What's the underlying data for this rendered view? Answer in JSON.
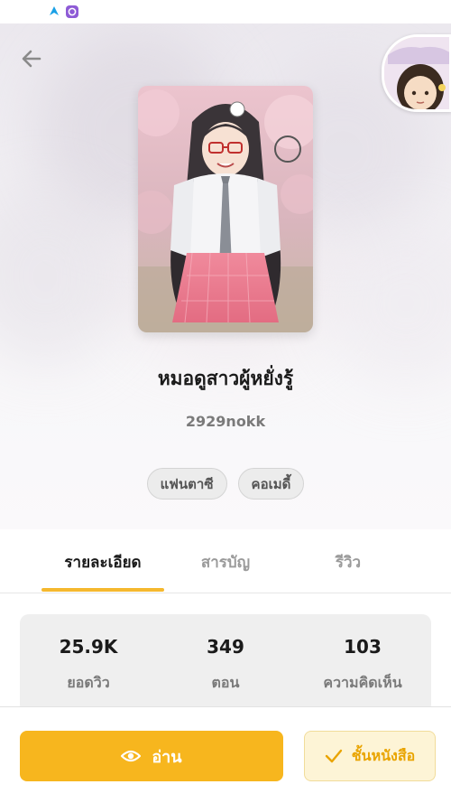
{
  "book": {
    "title": "หมอดูสาวผู้หยั่งรู้",
    "author": "2929nokk",
    "tags": [
      "แฟนตาซี",
      "คอเมดี้"
    ]
  },
  "tabs": [
    {
      "label": "รายละเอียด",
      "active": true
    },
    {
      "label": "สารบัญ",
      "active": false
    },
    {
      "label": "รีวิว",
      "active": false
    }
  ],
  "stats": [
    {
      "value": "25.9K",
      "label": "ยอดวิว"
    },
    {
      "value": "349",
      "label": "ตอน"
    },
    {
      "value": "103",
      "label": "ความคิดเห็น"
    }
  ],
  "actions": {
    "read_label": "อ่าน",
    "shelf_label": "ชั้นหนังสือ"
  },
  "icons": {
    "back": "arrow-left-icon",
    "read": "eye-icon",
    "shelf": "check-icon"
  },
  "colors": {
    "accent": "#f7b61e",
    "underline": "#f5b82e",
    "shelf_bg": "#fdf4d6",
    "shelf_text": "#e9a400"
  }
}
